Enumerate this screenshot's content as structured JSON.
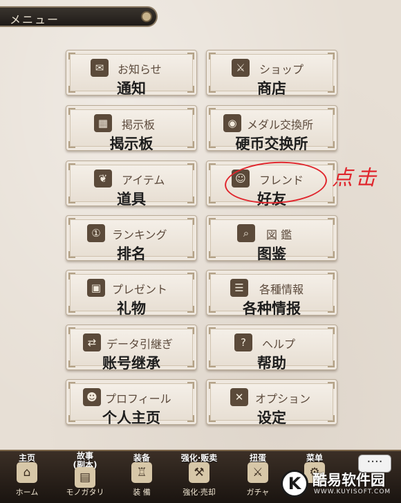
{
  "header": {
    "title": "メニュー"
  },
  "menu": [
    {
      "name": "notification",
      "jp": "お知らせ",
      "cn": "通知",
      "icon": "✉"
    },
    {
      "name": "shop",
      "jp": "ショップ",
      "cn": "商店",
      "icon": "⚔"
    },
    {
      "name": "bulletin-board",
      "jp": "掲示板",
      "cn": "揭示板",
      "icon": "▦"
    },
    {
      "name": "medal-exchange",
      "jp": "メダル交換所",
      "cn": "硬币交换所",
      "icon": "◉"
    },
    {
      "name": "items",
      "jp": "アイテム",
      "cn": "道具",
      "icon": "❦"
    },
    {
      "name": "friends",
      "jp": "フレンド",
      "cn": "好友",
      "icon": "☺"
    },
    {
      "name": "ranking",
      "jp": "ランキング",
      "cn": "排名",
      "icon": "①"
    },
    {
      "name": "encyclopedia",
      "jp": "図 鑑",
      "cn": "图鉴",
      "icon": "⌕"
    },
    {
      "name": "presents",
      "jp": "プレゼント",
      "cn": "礼物",
      "icon": "▣"
    },
    {
      "name": "information",
      "jp": "各種情報",
      "cn": "各种情报",
      "icon": "☰"
    },
    {
      "name": "data-transfer",
      "jp": "データ引継ぎ",
      "cn": "账号继承",
      "icon": "⇄"
    },
    {
      "name": "help",
      "jp": "ヘルプ",
      "cn": "帮助",
      "icon": "?"
    },
    {
      "name": "profile",
      "jp": "プロフィール",
      "cn": "个人主页",
      "icon": "☻"
    },
    {
      "name": "options",
      "jp": "オプション",
      "cn": "设定",
      "icon": "✕"
    }
  ],
  "annotation": {
    "note": "点击"
  },
  "bottom_nav": [
    {
      "name": "home",
      "cn": "主页",
      "jp": "ホーム",
      "icon": "⌂"
    },
    {
      "name": "story",
      "cn": "故事\n(副本)",
      "jp": "モノガタリ",
      "icon": "▤"
    },
    {
      "name": "equipment",
      "cn": "装备",
      "jp": "装 備",
      "icon": "♖"
    },
    {
      "name": "enhance-sell",
      "cn": "强化·贩卖",
      "jp": "強化·売却",
      "icon": "⚒"
    },
    {
      "name": "gacha",
      "cn": "扭蛋",
      "jp": "ガチャ",
      "icon": "⚔"
    },
    {
      "name": "menu",
      "cn": "菜单",
      "jp": "",
      "icon": "⚙"
    }
  ],
  "more_button": {
    "label": "····"
  },
  "watermark": {
    "logo": "K",
    "text": "酷易软件园",
    "sub": "WWW.KUYISOFT.COM"
  },
  "colors": {
    "accent_red": "#e0262d",
    "bar_dark": "#1a1410",
    "button_text": "#5c4a3c"
  }
}
